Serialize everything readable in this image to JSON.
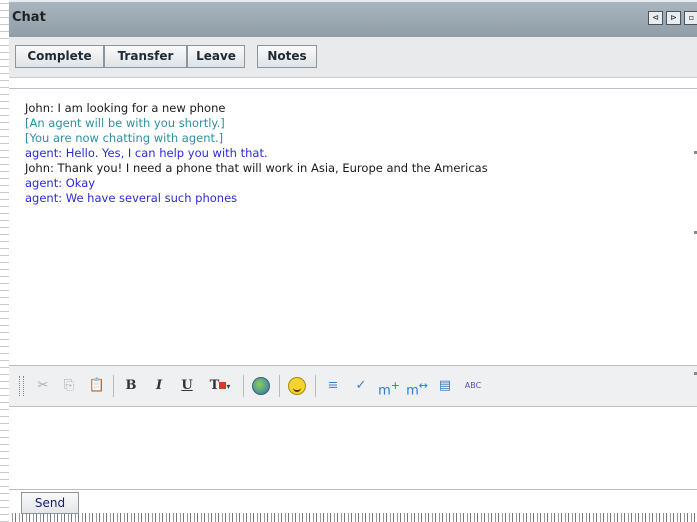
{
  "window": {
    "title": "Chat"
  },
  "actions": {
    "complete": "Complete",
    "transfer": "Transfer",
    "leave": "Leave",
    "notes": "Notes"
  },
  "transcript": {
    "lines": [
      {
        "text": "John: I am looking for a new phone",
        "color": "#1a1a1a"
      },
      {
        "text": "[An agent will be with you shortly.]",
        "color": "#2f8fa0"
      },
      {
        "text": "[You are now chatting with agent.]",
        "color": "#2f8fa0"
      },
      {
        "text": "agent: Hello. Yes, I can help you with that.",
        "color": "#2b2bd6"
      },
      {
        "text": "John: Thank you! I need a phone that will work in Asia, Europe and the Americas",
        "color": "#1a1a1a"
      },
      {
        "text": "agent: Okay",
        "color": "#2b2bd6"
      },
      {
        "text": "agent: We have several such phones",
        "color": "#2b2bd6"
      }
    ]
  },
  "editor_toolbar": {
    "bold": "B",
    "italic": "I",
    "underline": "U",
    "text_color": "T",
    "spellcheck": "ABC",
    "insert_m": "m"
  },
  "composer": {
    "value": "",
    "send_label": "Send"
  },
  "icons": [
    "cut-icon",
    "copy-icon",
    "paste-icon",
    "bold-icon",
    "italic-icon",
    "underline-icon",
    "text-color-icon",
    "insert-link-icon",
    "emoticon-icon",
    "insert-line-icon",
    "clear-format-icon",
    "add-macro-icon",
    "merge-macro-icon",
    "properties-icon",
    "spellcheck-icon"
  ]
}
